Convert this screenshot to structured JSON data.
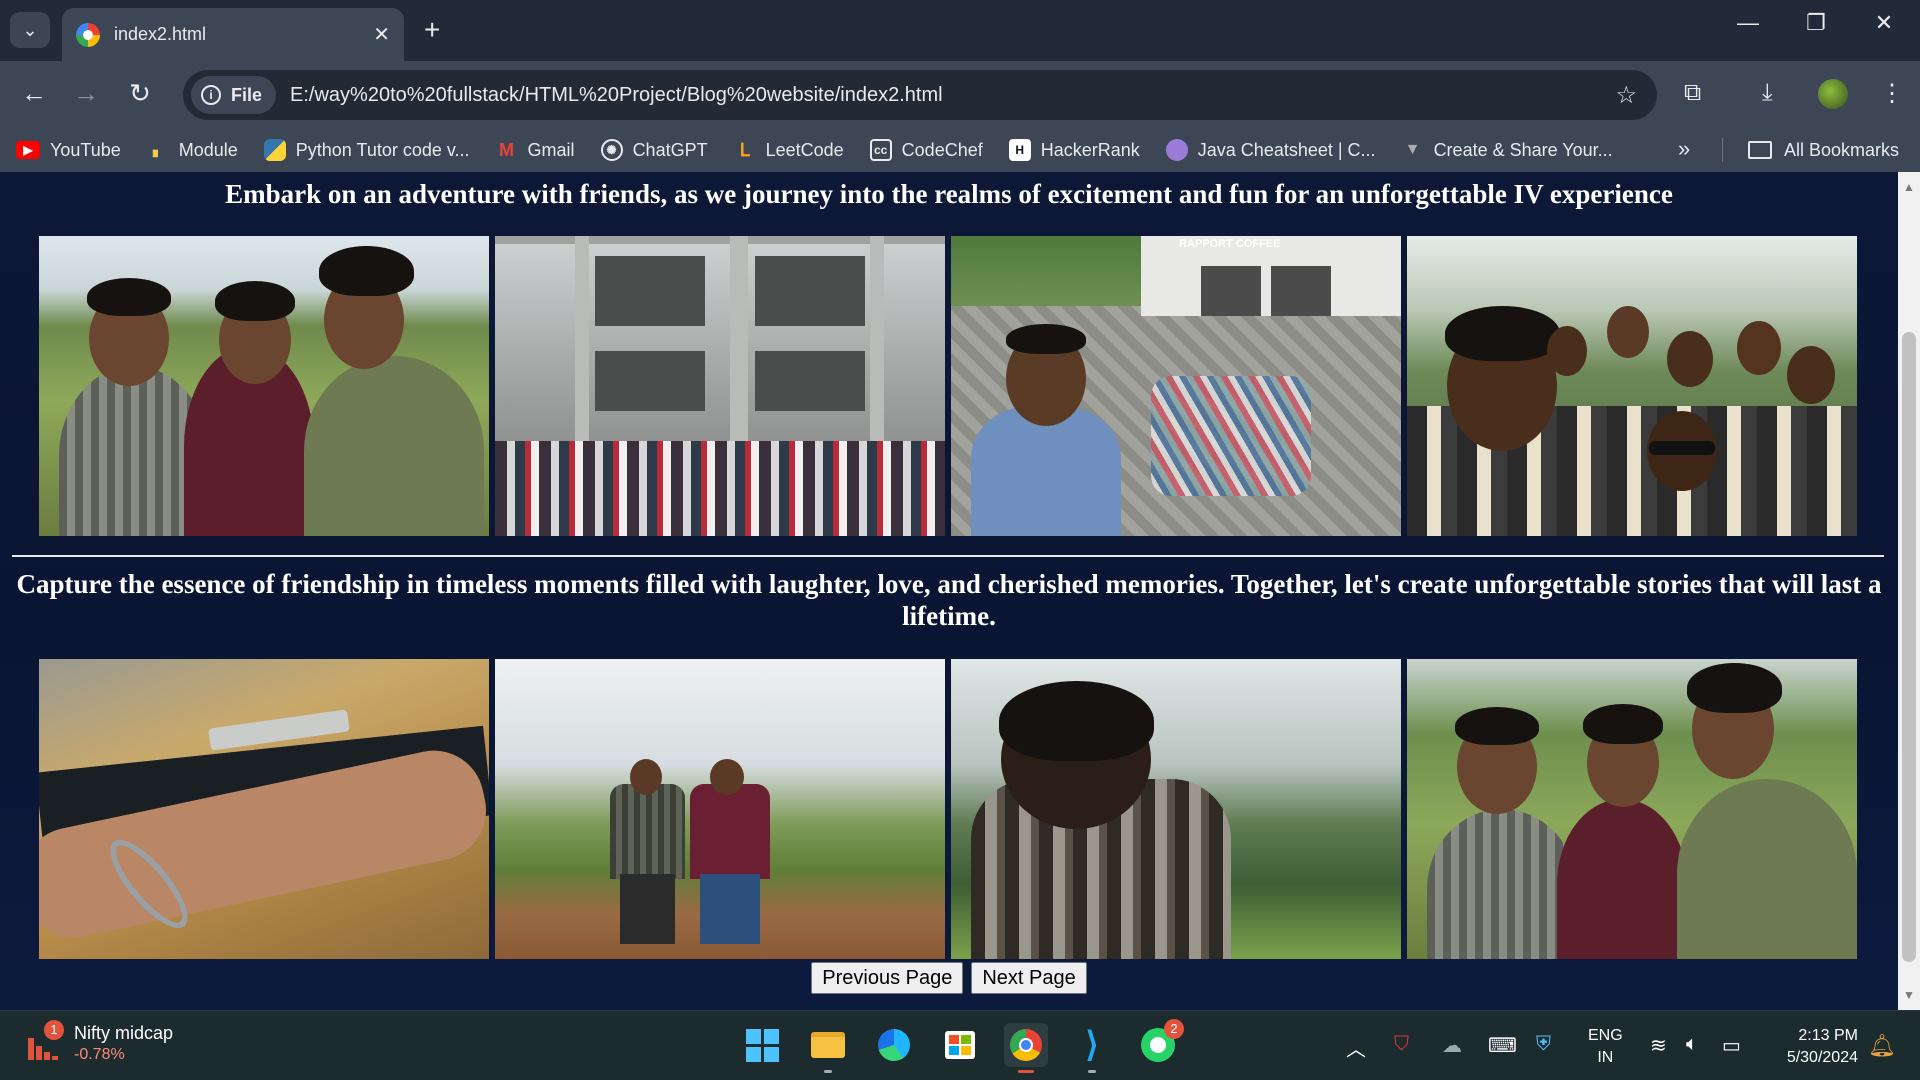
{
  "tab": {
    "title": "index2.html"
  },
  "toolbar": {
    "site_chip": "File",
    "url": "E:/way%20to%20fullstack/HTML%20Project/Blog%20website/index2.html"
  },
  "bookmarks": [
    {
      "label": "YouTube",
      "icon": "youtube-icon",
      "color": "#ff0000"
    },
    {
      "label": "Module",
      "icon": "module-icon",
      "color": "#f9c74f"
    },
    {
      "label": "Python Tutor code v...",
      "icon": "python-icon",
      "color": "#3776ab"
    },
    {
      "label": "Gmail",
      "icon": "gmail-icon",
      "color": "#ea4335"
    },
    {
      "label": "ChatGPT",
      "icon": "chatgpt-icon",
      "color": "#ffffff"
    },
    {
      "label": "LeetCode",
      "icon": "leetcode-icon",
      "color": "#ffa116"
    },
    {
      "label": "CodeChef",
      "icon": "codechef-icon",
      "color": "#ffffff"
    },
    {
      "label": "HackerRank",
      "icon": "hackerrank-icon",
      "color": "#00ea64"
    },
    {
      "label": "Java Cheatsheet | C...",
      "icon": "java-cheatsheet-icon",
      "color": "#9b7bd8"
    },
    {
      "label": "Create & Share Your...",
      "icon": "create-share-icon",
      "color": "#aaaaaa"
    }
  ],
  "bookmarks_all": "All Bookmarks",
  "page": {
    "heading1": "Embark on an adventure with friends, as we journey into the realms of excitement and fun for an unforgettable IV experience",
    "heading2": "Capture the essence of friendship in timeless moments filled with laughter, love, and cherished memories. Together, let's create unforgettable stories that will last a lifetime.",
    "photo_sign": "RAPPORT COFFEE",
    "prev_label": "Previous Page",
    "next_label": "Next Page"
  },
  "taskbar": {
    "widget_badge": "1",
    "widget_title": "Nifty midcap",
    "widget_value": "-0.78%",
    "whatsapp_badge": "2",
    "lang_line1": "ENG",
    "lang_line2": "IN",
    "time": "2:13 PM",
    "date": "5/30/2024"
  }
}
